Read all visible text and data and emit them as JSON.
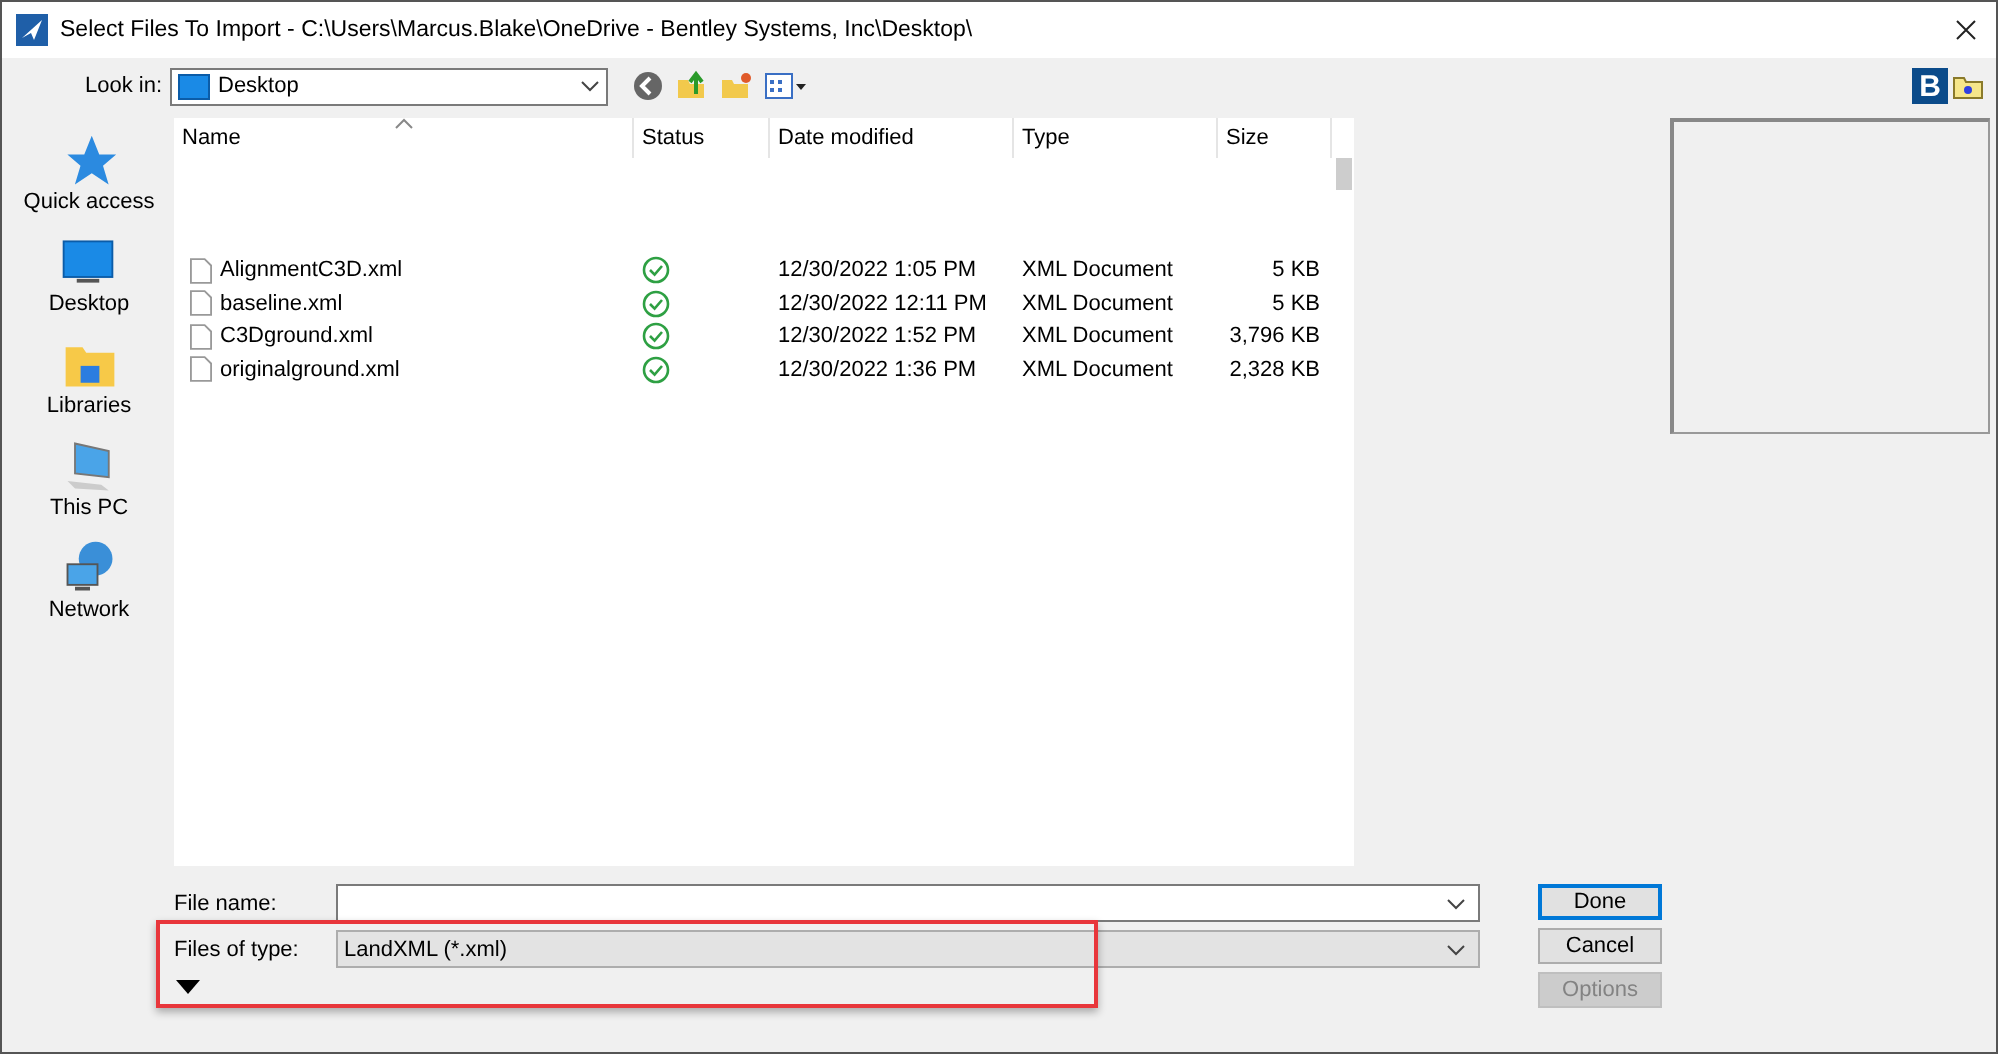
{
  "window": {
    "title": "Select Files To Import - C:\\Users\\Marcus.Blake\\OneDrive - Bentley Systems, Inc\\Desktop\\"
  },
  "toolbar": {
    "logo": "B"
  },
  "look_in": {
    "label": "Look in:",
    "value": "Desktop"
  },
  "sidebar": {
    "items": [
      {
        "label": "Quick access",
        "kind": "star"
      },
      {
        "label": "Desktop",
        "kind": "desktop"
      },
      {
        "label": "Libraries",
        "kind": "libraries"
      },
      {
        "label": "This PC",
        "kind": "pc"
      },
      {
        "label": "Network",
        "kind": "network"
      }
    ]
  },
  "table": {
    "columns": [
      "Name",
      "Status",
      "Date modified",
      "Type",
      "Size"
    ],
    "rows": [
      {
        "name": "AlignmentC3D.xml",
        "synced": true,
        "date": "12/30/2022 1:05 PM",
        "type": "XML Document",
        "size": "5 KB"
      },
      {
        "name": "baseline.xml",
        "synced": true,
        "date": "12/30/2022 12:11 PM",
        "type": "XML Document",
        "size": "5 KB"
      },
      {
        "name": "C3Dground.xml",
        "synced": true,
        "date": "12/30/2022 1:52 PM",
        "type": "XML Document",
        "size": "3,796 KB"
      },
      {
        "name": "originalground.xml",
        "synced": true,
        "date": "12/30/2022 1:36 PM",
        "type": "XML Document",
        "size": "2,328 KB"
      }
    ]
  },
  "file_name": {
    "label": "File name:"
  },
  "file_type": {
    "label": "Files of type:",
    "value": "LandXML (*.xml)",
    "disabled": true
  },
  "buttons": [
    {
      "label": "Done",
      "default": true,
      "disabled": false
    },
    {
      "label": "Cancel",
      "default": false,
      "disabled": false
    },
    {
      "label": "Options",
      "default": false,
      "disabled": true
    }
  ]
}
